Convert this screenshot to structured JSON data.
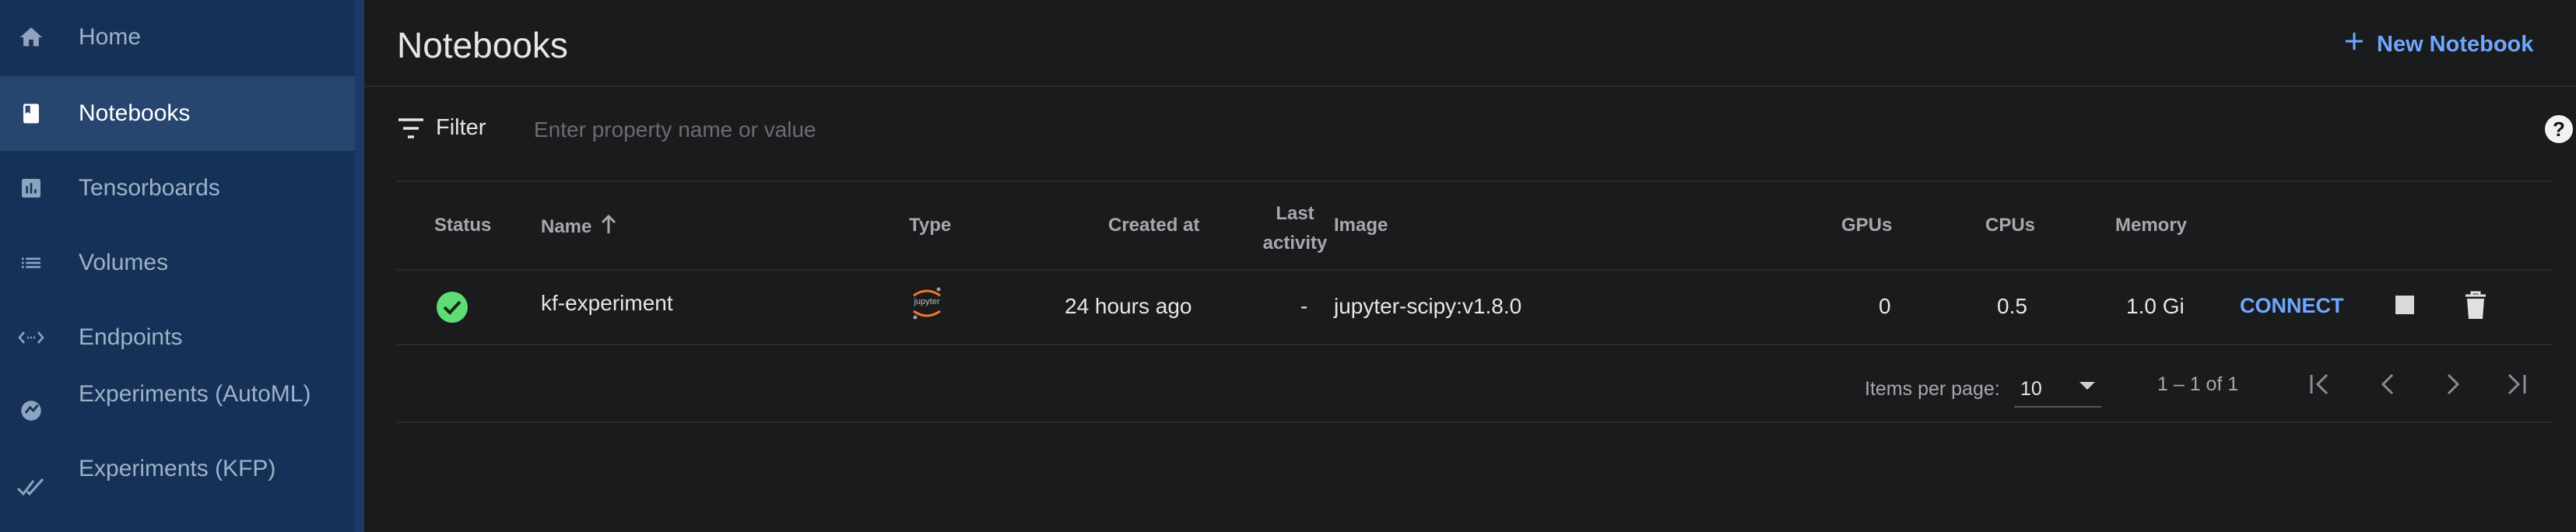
{
  "sidebar": {
    "items": [
      {
        "label": "Home",
        "icon": "home-icon"
      },
      {
        "label": "Notebooks",
        "icon": "book-icon",
        "active": true
      },
      {
        "label": "Tensorboards",
        "icon": "chart-icon"
      },
      {
        "label": "Volumes",
        "icon": "list-icon"
      },
      {
        "label": "Endpoints",
        "icon": "code-arrows-icon"
      },
      {
        "label": "Experiments (AutoML)",
        "icon": "automl-icon"
      },
      {
        "label": "Experiments (KFP)",
        "icon": "double-check-icon"
      }
    ]
  },
  "header": {
    "title": "Notebooks",
    "new_button": "New Notebook"
  },
  "filter": {
    "label": "Filter",
    "placeholder": "Enter property name or value"
  },
  "table": {
    "columns": [
      "Status",
      "Name",
      "Type",
      "Created at",
      "Last activity",
      "Image",
      "GPUs",
      "CPUs",
      "Memory"
    ],
    "last_activity_line1": "Last",
    "last_activity_line2": "activity",
    "rows": [
      {
        "status": "ready",
        "name": "kf-experiment",
        "type_label": "jupyter",
        "created": "24 hours ago",
        "last_activity": "-",
        "image": "jupyter-scipy:v1.8.0",
        "gpus": "0",
        "cpus": "0.5",
        "memory": "1.0 Gi",
        "connect": "CONNECT"
      }
    ]
  },
  "paginator": {
    "items_per_page_label": "Items per page:",
    "page_size": "10",
    "range": "1 – 1 of 1"
  },
  "colors": {
    "sidebar": "#163158",
    "accent": "#6ea8fe",
    "status_ok": "#4cd964",
    "background": "#1a1b1d"
  }
}
